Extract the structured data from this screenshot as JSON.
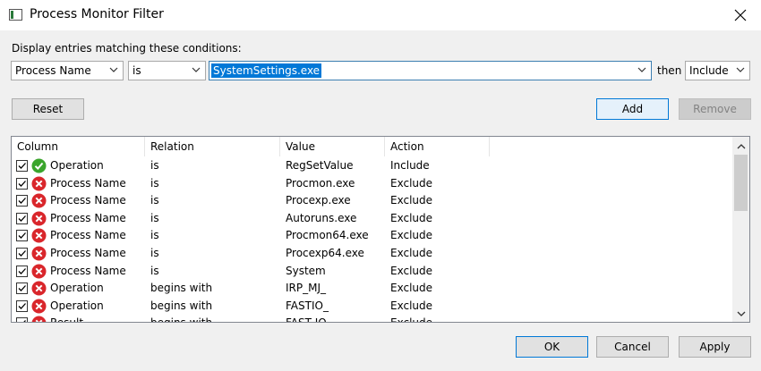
{
  "window": {
    "title": "Process Monitor Filter"
  },
  "conditions_label": "Display entries matching these conditions:",
  "filter": {
    "column_value": "Process Name",
    "relation_value": "is",
    "value_text": "SystemSettings.exe",
    "then_label": "then",
    "action_value": "Include"
  },
  "buttons": {
    "reset": "Reset",
    "add": "Add",
    "remove": "Remove",
    "ok": "OK",
    "cancel": "Cancel",
    "apply": "Apply"
  },
  "list": {
    "headers": [
      "Column",
      "Relation",
      "Value",
      "Action"
    ],
    "rows": [
      {
        "checked": true,
        "status": "include",
        "column": "Operation",
        "relation": "is",
        "value": "RegSetValue",
        "action": "Include"
      },
      {
        "checked": true,
        "status": "exclude",
        "column": "Process Name",
        "relation": "is",
        "value": "Procmon.exe",
        "action": "Exclude"
      },
      {
        "checked": true,
        "status": "exclude",
        "column": "Process Name",
        "relation": "is",
        "value": "Procexp.exe",
        "action": "Exclude"
      },
      {
        "checked": true,
        "status": "exclude",
        "column": "Process Name",
        "relation": "is",
        "value": "Autoruns.exe",
        "action": "Exclude"
      },
      {
        "checked": true,
        "status": "exclude",
        "column": "Process Name",
        "relation": "is",
        "value": "Procmon64.exe",
        "action": "Exclude"
      },
      {
        "checked": true,
        "status": "exclude",
        "column": "Process Name",
        "relation": "is",
        "value": "Procexp64.exe",
        "action": "Exclude"
      },
      {
        "checked": true,
        "status": "exclude",
        "column": "Process Name",
        "relation": "is",
        "value": "System",
        "action": "Exclude"
      },
      {
        "checked": true,
        "status": "exclude",
        "column": "Operation",
        "relation": "begins with",
        "value": "IRP_MJ_",
        "action": "Exclude"
      },
      {
        "checked": true,
        "status": "exclude",
        "column": "Operation",
        "relation": "begins with",
        "value": "FASTIO_",
        "action": "Exclude"
      },
      {
        "checked": true,
        "status": "exclude",
        "column": "Result",
        "relation": "begins with",
        "value": "FAST IO",
        "action": "Exclude"
      }
    ]
  },
  "icons": {
    "include": "green-check-icon",
    "exclude": "red-x-icon"
  },
  "colors": {
    "selection": "#0078d7",
    "include_icon": "#3aa52c",
    "exclude_icon": "#d9262b"
  }
}
